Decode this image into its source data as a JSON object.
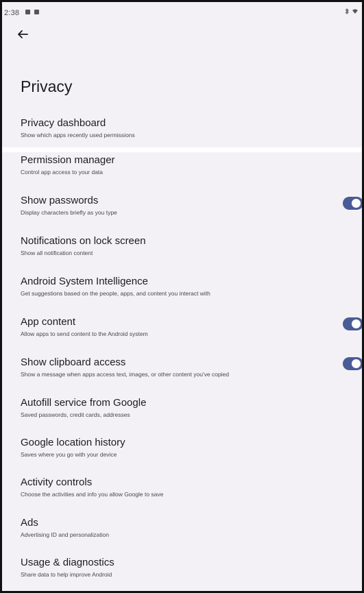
{
  "status_bar": {
    "time": "2:38"
  },
  "page": {
    "title": "Privacy"
  },
  "items": [
    {
      "title": "Privacy dashboard",
      "subtitle": "Show which apps recently used permissions"
    },
    {
      "title": "Permission manager",
      "subtitle": "Control app access to your data"
    },
    {
      "title": "Show passwords",
      "subtitle": "Display characters briefly as you type",
      "toggle": true
    },
    {
      "title": "Notifications on lock screen",
      "subtitle": "Show all notification content"
    },
    {
      "title": "Android System Intelligence",
      "subtitle": "Get suggestions based on the people, apps, and content you interact with"
    },
    {
      "title": "App content",
      "subtitle": "Allow apps to send content to the Android system",
      "toggle": true
    },
    {
      "title": "Show clipboard access",
      "subtitle": "Show a message when apps access text, images, or other content you've copied",
      "toggle": true
    },
    {
      "title": "Autofill service from Google",
      "subtitle": "Saved passwords, credit cards, addresses"
    },
    {
      "title": "Google location history",
      "subtitle": "Saves where you go with your device"
    },
    {
      "title": "Activity controls",
      "subtitle": "Choose the activities and info you allow Google to save"
    },
    {
      "title": "Ads",
      "subtitle": "Advertising ID and personalization"
    },
    {
      "title": "Usage & diagnostics",
      "subtitle": "Share data to help improve Android"
    }
  ],
  "colors": {
    "toggle_on": "#4a5c95",
    "background": "#f4f1f6"
  },
  "icons": {
    "back": "arrow-back-icon"
  }
}
